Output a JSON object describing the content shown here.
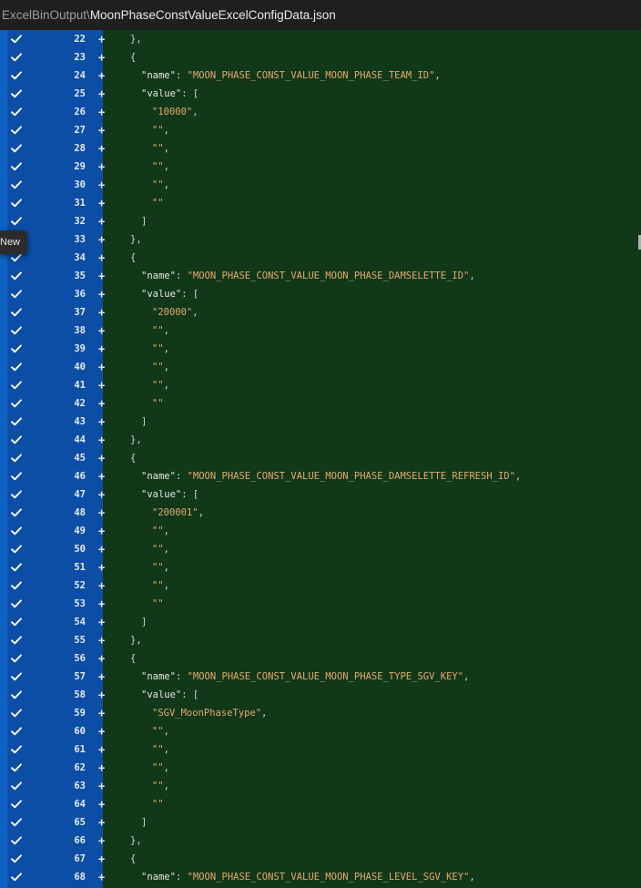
{
  "header": {
    "path_prefix": "ExcelBinOutput\\",
    "file_name": "MoonPhaseConstValueExcelConfigData.json"
  },
  "tooltip": {
    "label": "New"
  },
  "diff_marker": "+",
  "colors": {
    "background": "#12381a",
    "gutter": "#0c4ea6",
    "gutter_stripe": "#0e62c4",
    "header_bg": "#1f1f1f",
    "string": "#e5a96a"
  },
  "lines": [
    {
      "num": "22",
      "indent": 0,
      "tokens": [
        {
          "t": "p",
          "v": "},"
        }
      ]
    },
    {
      "num": "23",
      "indent": 0,
      "tokens": [
        {
          "t": "p",
          "v": "{"
        }
      ]
    },
    {
      "num": "24",
      "indent": 1,
      "tokens": [
        {
          "t": "k",
          "v": "\"name\""
        },
        {
          "t": "p",
          "v": ": "
        },
        {
          "t": "s",
          "v": "\"MOON_PHASE_CONST_VALUE_MOON_PHASE_TEAM_ID\""
        },
        {
          "t": "p",
          "v": ","
        }
      ]
    },
    {
      "num": "25",
      "indent": 1,
      "tokens": [
        {
          "t": "k",
          "v": "\"value\""
        },
        {
          "t": "p",
          "v": ": ["
        }
      ]
    },
    {
      "num": "26",
      "indent": 2,
      "tokens": [
        {
          "t": "s",
          "v": "\"10000\""
        },
        {
          "t": "p",
          "v": ","
        }
      ]
    },
    {
      "num": "27",
      "indent": 2,
      "tokens": [
        {
          "t": "s",
          "v": "\"\""
        },
        {
          "t": "p",
          "v": ","
        }
      ]
    },
    {
      "num": "28",
      "indent": 2,
      "tokens": [
        {
          "t": "s",
          "v": "\"\""
        },
        {
          "t": "p",
          "v": ","
        }
      ]
    },
    {
      "num": "29",
      "indent": 2,
      "tokens": [
        {
          "t": "s",
          "v": "\"\""
        },
        {
          "t": "p",
          "v": ","
        }
      ]
    },
    {
      "num": "30",
      "indent": 2,
      "tokens": [
        {
          "t": "s",
          "v": "\"\""
        },
        {
          "t": "p",
          "v": ","
        }
      ]
    },
    {
      "num": "31",
      "indent": 2,
      "tokens": [
        {
          "t": "s",
          "v": "\"\""
        }
      ]
    },
    {
      "num": "32",
      "indent": 1,
      "tokens": [
        {
          "t": "p",
          "v": "]"
        }
      ]
    },
    {
      "num": "33",
      "indent": 0,
      "tokens": [
        {
          "t": "p",
          "v": "},"
        }
      ]
    },
    {
      "num": "34",
      "indent": 0,
      "tokens": [
        {
          "t": "p",
          "v": "{"
        }
      ]
    },
    {
      "num": "35",
      "indent": 1,
      "tokens": [
        {
          "t": "k",
          "v": "\"name\""
        },
        {
          "t": "p",
          "v": ": "
        },
        {
          "t": "s",
          "v": "\"MOON_PHASE_CONST_VALUE_MOON_PHASE_DAMSELETTE_ID\""
        },
        {
          "t": "p",
          "v": ","
        }
      ]
    },
    {
      "num": "36",
      "indent": 1,
      "tokens": [
        {
          "t": "k",
          "v": "\"value\""
        },
        {
          "t": "p",
          "v": ": ["
        }
      ]
    },
    {
      "num": "37",
      "indent": 2,
      "tokens": [
        {
          "t": "s",
          "v": "\"20000\""
        },
        {
          "t": "p",
          "v": ","
        }
      ]
    },
    {
      "num": "38",
      "indent": 2,
      "tokens": [
        {
          "t": "s",
          "v": "\"\""
        },
        {
          "t": "p",
          "v": ","
        }
      ]
    },
    {
      "num": "39",
      "indent": 2,
      "tokens": [
        {
          "t": "s",
          "v": "\"\""
        },
        {
          "t": "p",
          "v": ","
        }
      ]
    },
    {
      "num": "40",
      "indent": 2,
      "tokens": [
        {
          "t": "s",
          "v": "\"\""
        },
        {
          "t": "p",
          "v": ","
        }
      ]
    },
    {
      "num": "41",
      "indent": 2,
      "tokens": [
        {
          "t": "s",
          "v": "\"\""
        },
        {
          "t": "p",
          "v": ","
        }
      ]
    },
    {
      "num": "42",
      "indent": 2,
      "tokens": [
        {
          "t": "s",
          "v": "\"\""
        }
      ]
    },
    {
      "num": "43",
      "indent": 1,
      "tokens": [
        {
          "t": "p",
          "v": "]"
        }
      ]
    },
    {
      "num": "44",
      "indent": 0,
      "tokens": [
        {
          "t": "p",
          "v": "},"
        }
      ]
    },
    {
      "num": "45",
      "indent": 0,
      "tokens": [
        {
          "t": "p",
          "v": "{"
        }
      ]
    },
    {
      "num": "46",
      "indent": 1,
      "tokens": [
        {
          "t": "k",
          "v": "\"name\""
        },
        {
          "t": "p",
          "v": ": "
        },
        {
          "t": "s",
          "v": "\"MOON_PHASE_CONST_VALUE_MOON_PHASE_DAMSELETTE_REFRESH_ID\""
        },
        {
          "t": "p",
          "v": ","
        }
      ]
    },
    {
      "num": "47",
      "indent": 1,
      "tokens": [
        {
          "t": "k",
          "v": "\"value\""
        },
        {
          "t": "p",
          "v": ": ["
        }
      ]
    },
    {
      "num": "48",
      "indent": 2,
      "tokens": [
        {
          "t": "s",
          "v": "\"200001\""
        },
        {
          "t": "p",
          "v": ","
        }
      ]
    },
    {
      "num": "49",
      "indent": 2,
      "tokens": [
        {
          "t": "s",
          "v": "\"\""
        },
        {
          "t": "p",
          "v": ","
        }
      ]
    },
    {
      "num": "50",
      "indent": 2,
      "tokens": [
        {
          "t": "s",
          "v": "\"\""
        },
        {
          "t": "p",
          "v": ","
        }
      ]
    },
    {
      "num": "51",
      "indent": 2,
      "tokens": [
        {
          "t": "s",
          "v": "\"\""
        },
        {
          "t": "p",
          "v": ","
        }
      ]
    },
    {
      "num": "52",
      "indent": 2,
      "tokens": [
        {
          "t": "s",
          "v": "\"\""
        },
        {
          "t": "p",
          "v": ","
        }
      ]
    },
    {
      "num": "53",
      "indent": 2,
      "tokens": [
        {
          "t": "s",
          "v": "\"\""
        }
      ]
    },
    {
      "num": "54",
      "indent": 1,
      "tokens": [
        {
          "t": "p",
          "v": "]"
        }
      ]
    },
    {
      "num": "55",
      "indent": 0,
      "tokens": [
        {
          "t": "p",
          "v": "},"
        }
      ]
    },
    {
      "num": "56",
      "indent": 0,
      "tokens": [
        {
          "t": "p",
          "v": "{"
        }
      ]
    },
    {
      "num": "57",
      "indent": 1,
      "tokens": [
        {
          "t": "k",
          "v": "\"name\""
        },
        {
          "t": "p",
          "v": ": "
        },
        {
          "t": "s",
          "v": "\"MOON_PHASE_CONST_VALUE_MOON_PHASE_TYPE_SGV_KEY\""
        },
        {
          "t": "p",
          "v": ","
        }
      ]
    },
    {
      "num": "58",
      "indent": 1,
      "tokens": [
        {
          "t": "k",
          "v": "\"value\""
        },
        {
          "t": "p",
          "v": ": ["
        }
      ]
    },
    {
      "num": "59",
      "indent": 2,
      "tokens": [
        {
          "t": "s",
          "v": "\"SGV_MoonPhaseType\""
        },
        {
          "t": "p",
          "v": ","
        }
      ]
    },
    {
      "num": "60",
      "indent": 2,
      "tokens": [
        {
          "t": "s",
          "v": "\"\""
        },
        {
          "t": "p",
          "v": ","
        }
      ]
    },
    {
      "num": "61",
      "indent": 2,
      "tokens": [
        {
          "t": "s",
          "v": "\"\""
        },
        {
          "t": "p",
          "v": ","
        }
      ]
    },
    {
      "num": "62",
      "indent": 2,
      "tokens": [
        {
          "t": "s",
          "v": "\"\""
        },
        {
          "t": "p",
          "v": ","
        }
      ]
    },
    {
      "num": "63",
      "indent": 2,
      "tokens": [
        {
          "t": "s",
          "v": "\"\""
        },
        {
          "t": "p",
          "v": ","
        }
      ]
    },
    {
      "num": "64",
      "indent": 2,
      "tokens": [
        {
          "t": "s",
          "v": "\"\""
        }
      ]
    },
    {
      "num": "65",
      "indent": 1,
      "tokens": [
        {
          "t": "p",
          "v": "]"
        }
      ]
    },
    {
      "num": "66",
      "indent": 0,
      "tokens": [
        {
          "t": "p",
          "v": "},"
        }
      ]
    },
    {
      "num": "67",
      "indent": 0,
      "tokens": [
        {
          "t": "p",
          "v": "{"
        }
      ]
    },
    {
      "num": "68",
      "indent": 1,
      "tokens": [
        {
          "t": "k",
          "v": "\"name\""
        },
        {
          "t": "p",
          "v": ": "
        },
        {
          "t": "s",
          "v": "\"MOON_PHASE_CONST_VALUE_MOON_PHASE_LEVEL_SGV_KEY\""
        },
        {
          "t": "p",
          "v": ","
        }
      ]
    }
  ]
}
